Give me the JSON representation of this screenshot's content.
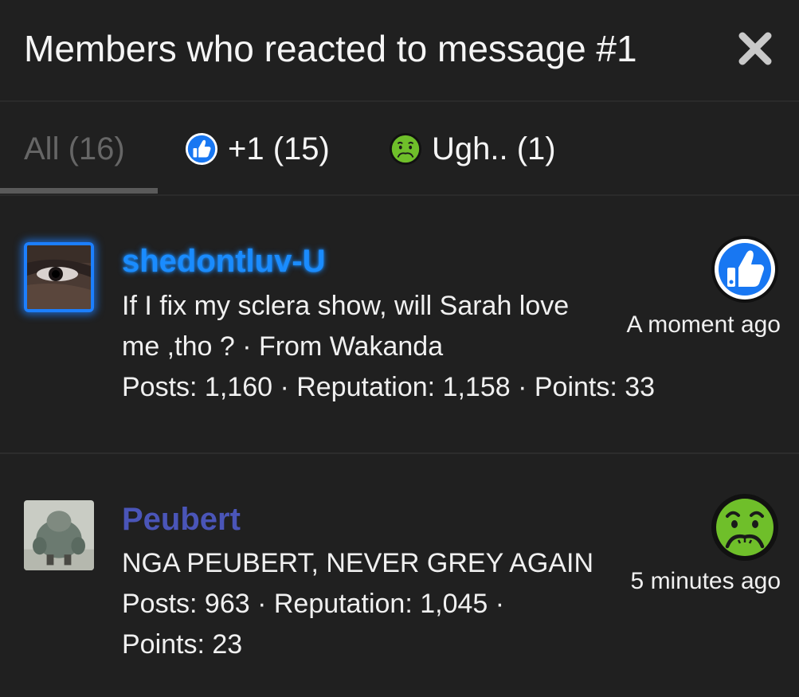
{
  "dialog": {
    "title": "Members who reacted to message #1",
    "close_icon": "close-x-icon"
  },
  "tabs": [
    {
      "label": "All (16)",
      "active": true
    },
    {
      "label": "+1 (15)",
      "icon": "thumbs-up-icon"
    },
    {
      "label": "Ugh.. (1)",
      "icon": "nauseated-face-icon"
    }
  ],
  "members": [
    {
      "username": "shedontluv-U",
      "info_line1": "If I fix my sclera show, will Sarah love",
      "info_line2": "me ,tho ? · From Wakanda",
      "info_line3": "Posts: 1,160 · Reputation: 1,158 · Points: 33",
      "time": "A moment ago",
      "reaction": "thumbs-up-icon",
      "name_color": "#1a8cff"
    },
    {
      "username": "Peubert",
      "info_line1": "NGA PEUBERT, NEVER GREY AGAIN",
      "info_line2": "Posts: 963 · Reputation: 1,045 ·",
      "info_line3": "Points: 23",
      "time": "5 minutes ago",
      "reaction": "nauseated-face-icon",
      "name_color": "#4a55b8"
    }
  ],
  "colors": {
    "background": "#202020",
    "thumbs_blue": "#1877f2",
    "nauseated_green": "#6fbf2a"
  }
}
